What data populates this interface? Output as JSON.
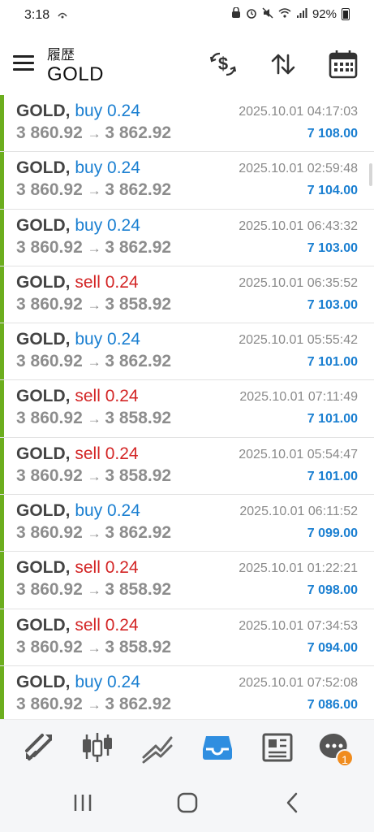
{
  "status_bar": {
    "time": "3:18",
    "battery": "92%"
  },
  "header": {
    "subtitle": "履歴",
    "title": "GOLD"
  },
  "trades": [
    {
      "symbol": "GOLD,",
      "side": "buy",
      "volume": "0.24",
      "open": "3 860.92",
      "close": "3 862.92",
      "time": "2025.10.01 04:17:03",
      "profit": "7 108.00"
    },
    {
      "symbol": "GOLD,",
      "side": "buy",
      "volume": "0.24",
      "open": "3 860.92",
      "close": "3 862.92",
      "time": "2025.10.01 02:59:48",
      "profit": "7 104.00"
    },
    {
      "symbol": "GOLD,",
      "side": "buy",
      "volume": "0.24",
      "open": "3 860.92",
      "close": "3 862.92",
      "time": "2025.10.01 06:43:32",
      "profit": "7 103.00"
    },
    {
      "symbol": "GOLD,",
      "side": "sell",
      "volume": "0.24",
      "open": "3 860.92",
      "close": "3 858.92",
      "time": "2025.10.01 06:35:52",
      "profit": "7 103.00"
    },
    {
      "symbol": "GOLD,",
      "side": "buy",
      "volume": "0.24",
      "open": "3 860.92",
      "close": "3 862.92",
      "time": "2025.10.01 05:55:42",
      "profit": "7 101.00"
    },
    {
      "symbol": "GOLD,",
      "side": "sell",
      "volume": "0.24",
      "open": "3 860.92",
      "close": "3 858.92",
      "time": "2025.10.01 07:11:49",
      "profit": "7 101.00"
    },
    {
      "symbol": "GOLD,",
      "side": "sell",
      "volume": "0.24",
      "open": "3 860.92",
      "close": "3 858.92",
      "time": "2025.10.01 05:54:47",
      "profit": "7 101.00"
    },
    {
      "symbol": "GOLD,",
      "side": "buy",
      "volume": "0.24",
      "open": "3 860.92",
      "close": "3 862.92",
      "time": "2025.10.01 06:11:52",
      "profit": "7 099.00"
    },
    {
      "symbol": "GOLD,",
      "side": "sell",
      "volume": "0.24",
      "open": "3 860.92",
      "close": "3 858.92",
      "time": "2025.10.01 01:22:21",
      "profit": "7 098.00"
    },
    {
      "symbol": "GOLD,",
      "side": "sell",
      "volume": "0.24",
      "open": "3 860.92",
      "close": "3 858.92",
      "time": "2025.10.01 07:34:53",
      "profit": "7 094.00"
    },
    {
      "symbol": "GOLD,",
      "side": "buy",
      "volume": "0.24",
      "open": "3 860.92",
      "close": "3 862.92",
      "time": "2025.10.01 07:52:08",
      "profit": "7 086.00"
    }
  ],
  "tabbar": {
    "items": [
      {
        "icon": "trade-icon"
      },
      {
        "icon": "candlestick-chart-icon"
      },
      {
        "icon": "trend-chart-icon"
      },
      {
        "icon": "inbox-history-icon",
        "active": true
      },
      {
        "icon": "news-icon"
      },
      {
        "icon": "chat-icon",
        "badge": "1"
      }
    ]
  },
  "colors": {
    "buy": "#1a7fd1",
    "sell": "#d32525",
    "profit": "#1a7fd1",
    "row_accent": "#6cae1e",
    "active_tab": "#2f8ee0",
    "badge": "#f08c1e"
  }
}
